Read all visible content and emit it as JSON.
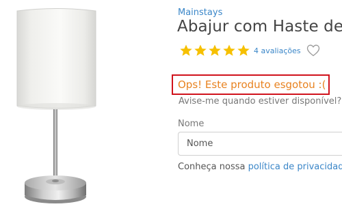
{
  "product": {
    "brand": "Mainstays",
    "title": "Abajur com Haste de",
    "image_alt": "table-lamp-white-shade-photo",
    "rating": 5,
    "rating_max": 5,
    "review_count_label": "4 avaliações"
  },
  "availability": {
    "soldout_message": "Ops! Este produto esgotou :(",
    "notify_prompt": "Avise-me quando estiver disponível?"
  },
  "notify_form": {
    "name_label": "Nome",
    "name_placeholder": "Nome",
    "privacy_prefix": "Conheça nossa ",
    "privacy_link": "política de privacidade"
  },
  "colors": {
    "link_blue": "#3a86c8",
    "star_yellow": "#f6c000",
    "soldout_orange": "#e8821f",
    "highlight_red": "#d0111b"
  },
  "icons": {
    "star": "star-icon",
    "favorite": "heart-outline-icon"
  }
}
